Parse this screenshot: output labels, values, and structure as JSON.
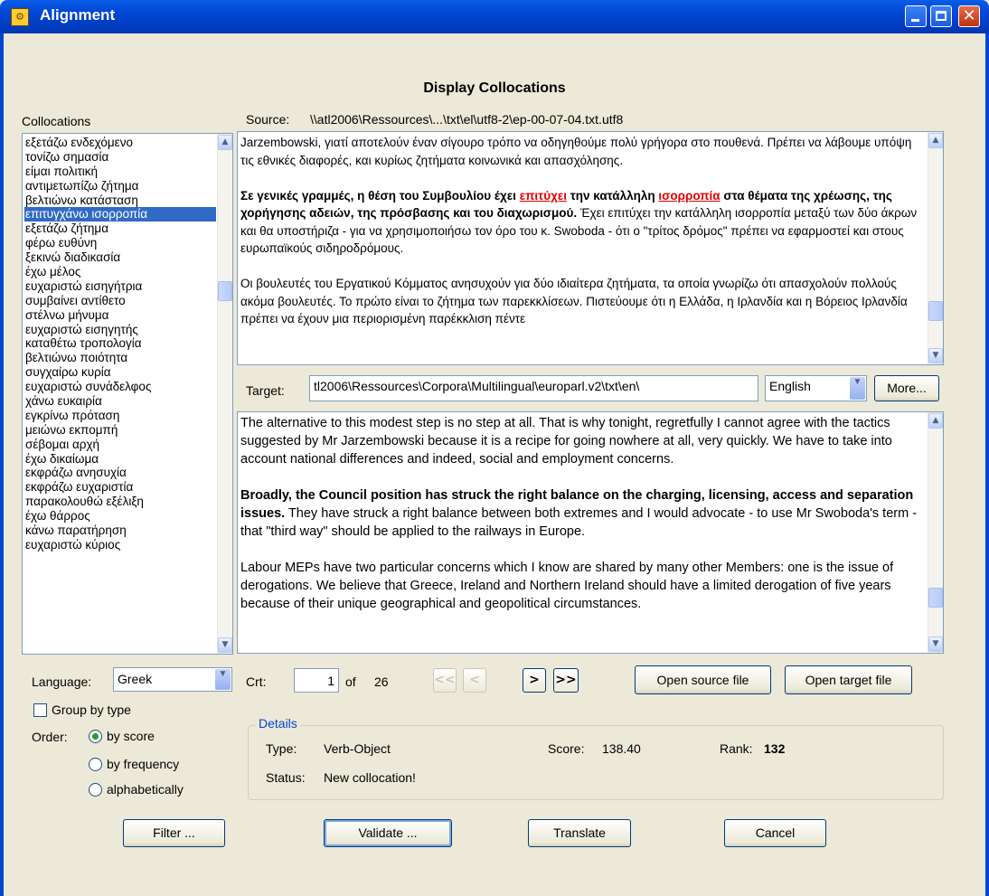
{
  "window": {
    "title": "Alignment"
  },
  "heading": "Display Collocations",
  "collocations_label": "Collocations",
  "source": {
    "label": "Source:",
    "path": "\\\\atl2006\\Ressources\\...\\txt\\el\\utf8-2\\ep-00-07-04.txt.utf8",
    "text": {
      "p1": "Jarzembowski, γιατί αποτελούν έναν σίγουρο τρόπο να οδηγηθούμε πολύ γρήγορα στο πουθενά. Πρέπει να λάβουμε υπόψη τις εθνικές διαφορές, και κυρίως ζητήματα κοινωνικά και απασχόλησης.",
      "p2_bold_a": "Σε γενικές γραμμές, η θέση του Συμβουλίου έχει ",
      "p2_red1": "επιτύχει",
      "p2_bold_b": " την κατάλληλη ",
      "p2_red2": "ισορροπία",
      "p2_bold_c": " στα θέματα της χρέωσης, της χορήγησης αδειών, της πρόσβασης και του διαχωρισμού.",
      "p2_rest": " Έχει επιτύχει την κατάλληλη ισορροπία μεταξύ των δύο άκρων και θα υποστήριζα - για να χρησιμοποιήσω τον όρο του κ. Swoboda - ότι ο \"τρίτος δρόμος\" πρέπει να εφαρμοστεί και στους ευρωπαϊκούς σιδηροδρόμους.",
      "p3": "Οι βουλευτές του Εργατικού Κόμματος ανησυχούν για δύο ιδιαίτερα ζητήματα, τα οποία γνωρίζω ότι απασχολούν πολλούς ακόμα βουλευτές. Το πρώτο είναι το ζήτημα των παρεκκλίσεων. Πιστεύουμε ότι η Ελλάδα, η Ιρλανδία και η Βόρειος Ιρλανδία πρέπει να έχουν μια περιορισμένη παρέκκλιση πέντε"
    }
  },
  "target": {
    "label": "Target:",
    "path": "tl2006\\Ressources\\Corpora\\Multilingual\\europarl.v2\\txt\\en\\",
    "language": "English",
    "more_button": "More...",
    "text": {
      "p1": "The alternative to this modest step is no step at all. That is why tonight, regretfully I cannot agree with the tactics suggested by Mr Jarzembowski because it is a recipe for going nowhere at all, very quickly. We have to take into account national differences and indeed, social and employment concerns.",
      "p2_bold": "Broadly, the Council position has struck the right balance on the charging, licensing, access and separation issues.",
      "p2_rest": " They have struck a right balance between both extremes and I would advocate - to use Mr Swoboda's term - that \"third way\" should be applied to the railways in Europe.",
      "p3": "Labour MEPs have two particular concerns which I know are shared by many other Members: one is the issue of derogations. We believe that Greece, Ireland and Northern Ireland should have a limited derogation of five years because of their unique geographical and geopolitical circumstances."
    }
  },
  "collocations": [
    "εξετάζω ενδεχόμενο",
    "τονίζω σημασία",
    "είμαι πολιτική",
    "αντιμετωπίζω ζήτημα",
    "βελτιώνω κατάσταση",
    "επιτυγχάνω ισορροπία",
    "εξετάζω ζήτημα",
    "φέρω ευθύνη",
    "ξεκινώ διαδικασία",
    "έχω μέλος",
    "ευχαριστώ εισηγήτρια",
    "συμβαίνει αντίθετο",
    "στέλνω μήνυμα",
    "ευχαριστώ εισηγητής",
    "καταθέτω τροπολογία",
    "βελτιώνω ποιότητα",
    "συγχαίρω κυρία",
    "ευχαριστώ συνάδελφος",
    "χάνω ευκαιρία",
    "εγκρίνω πρόταση",
    "μειώνω εκπομπή",
    "σέβομαι αρχή",
    "έχω δικαίωμα",
    "εκφράζω ανησυχία",
    "εκφράζω ευχαριστία",
    "παρακολουθώ εξέλιξη",
    "έχω θάρρος",
    "κάνω παρατήρηση",
    "ευχαριστώ κύριος"
  ],
  "selected_collocation": "επιτυγχάνω ισορροπία",
  "language": {
    "label": "Language:",
    "value": "Greek"
  },
  "group_by_type": {
    "label": "Group by type",
    "checked": false
  },
  "order": {
    "label": "Order:",
    "options": [
      "by score",
      "by frequency",
      "alphabetically"
    ],
    "selected": "by score"
  },
  "navigation": {
    "crt_label": "Crt:",
    "crt_value": "1",
    "of_label": "of",
    "total": "26",
    "first": "<<",
    "prev": "<",
    "next": ">",
    "last": ">>"
  },
  "open_source_button": "Open source file",
  "open_target_button": "Open target file",
  "details": {
    "title": "Details",
    "type_label": "Type:",
    "type_value": "Verb-Object",
    "score_label": "Score:",
    "score_value": "138.40",
    "rank_label": "Rank:",
    "rank_value": "132",
    "status_label": "Status:",
    "status_value": "New collocation!"
  },
  "buttons": {
    "filter": "Filter ...",
    "validate": "Validate ...",
    "translate": "Translate",
    "cancel": "Cancel"
  }
}
